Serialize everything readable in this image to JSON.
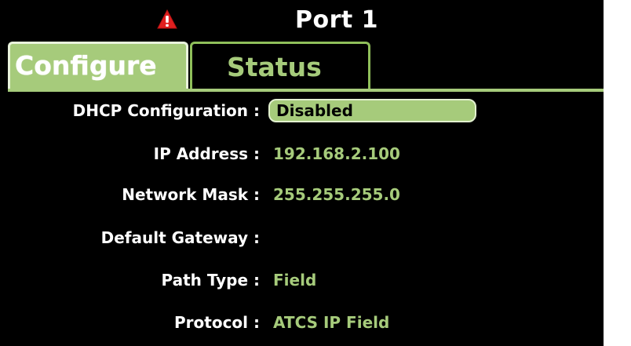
{
  "window": {
    "title": "Port 1",
    "alert_icon": "warning-triangle-icon",
    "alert_color": "#e02020"
  },
  "tabs": [
    {
      "label": "Configure",
      "active": true
    },
    {
      "label": "Status",
      "active": false
    }
  ],
  "fields": {
    "dhcp": {
      "label": "DHCP Configuration :",
      "value": "Disabled"
    },
    "ip_address": {
      "label": "IP Address :",
      "value": "192.168.2.100"
    },
    "network_mask": {
      "label": "Network Mask :",
      "value": "255.255.255.0"
    },
    "default_gateway": {
      "label": "Default Gateway :",
      "value": ""
    },
    "path_type": {
      "label": "Path Type :",
      "value": "Field"
    },
    "protocol": {
      "label": "Protocol :",
      "value": "ATCS IP Field"
    }
  },
  "colors": {
    "background": "#000000",
    "accent_green": "#a6cb7b",
    "text": "#ffffff"
  }
}
